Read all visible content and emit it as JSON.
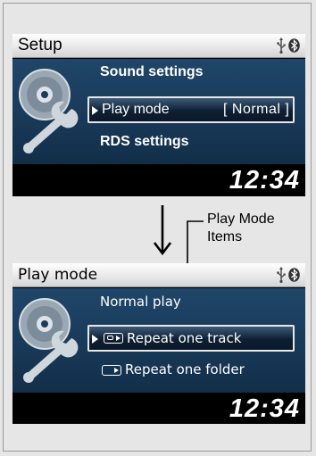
{
  "screens": [
    {
      "title": "Setup",
      "menu": {
        "item1": "Sound settings",
        "selected_label": "Play mode",
        "selected_value": "[ Normal ]",
        "item3": "RDS settings"
      },
      "clock": "12:34"
    },
    {
      "title": "Play mode",
      "menu": {
        "item1": "Normal play",
        "selected_label": "Repeat one track",
        "item3": "Repeat one folder"
      },
      "clock": "12:34"
    }
  ],
  "callout": {
    "line1": "Play Mode",
    "line2": "Items"
  },
  "icons": [
    "usb-icon",
    "bluetooth-icon",
    "setup-disc-wrench-icon",
    "selection-arrow-icon",
    "repeat-track-icon",
    "repeat-folder-icon",
    "down-arrow-icon"
  ],
  "colors": {
    "screen_bg": "#000000",
    "content_bg": "#1a3c5c",
    "title_bar": "#e9e9e9",
    "text": "#ffffff",
    "highlight_border": "#e8e8e8"
  }
}
